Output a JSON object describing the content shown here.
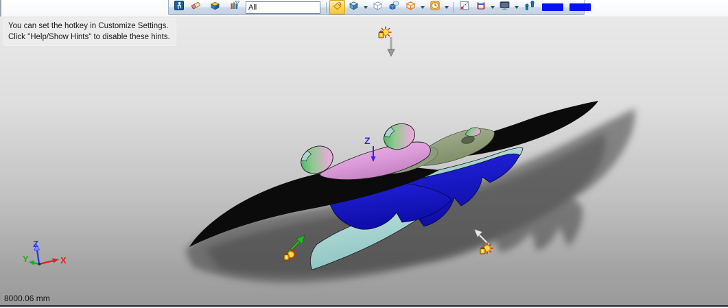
{
  "toolbar": {
    "filter_value": "All",
    "active_tool": "view-orientation",
    "icons": [
      "walk-navigation",
      "eraser",
      "box-display",
      "selection-filter",
      "view-orientation",
      "display-style-shaded",
      "display-style-wireframe",
      "display-style-hidden-lines",
      "appearance-wirebox",
      "scene-clock",
      "section-view",
      "measure",
      "screen-capture",
      "walk-figures",
      "blue-swatch",
      "blue-swatch"
    ]
  },
  "hint": {
    "line1": "You can set the hotkey in Customize Settings.",
    "line2": "Click \"Help/Show Hints\" to disable these hints."
  },
  "viewport": {
    "measurement": "8000.06 mm",
    "axis_marker_label": "Z",
    "triad": {
      "x": "X",
      "y": "Y",
      "z": "Z",
      "x_color": "#e02020",
      "y_color": "#18b018",
      "z_color": "#2a3ce8"
    },
    "lights": [
      "directional-light-top",
      "directional-light-left",
      "directional-light-right"
    ],
    "colors": {
      "background_top": "#e9e9e9",
      "background_bottom": "#9a9a9a",
      "wing_black": "#0b0b0b",
      "wing_blue": "#1414cc",
      "wing_teal": "#a2d5d0",
      "fuselage_pink": "#dfa0dc",
      "deck_olive": "#94a07e",
      "nacelle_green": "#52b96a",
      "shadow": "#3f3f3f"
    }
  }
}
